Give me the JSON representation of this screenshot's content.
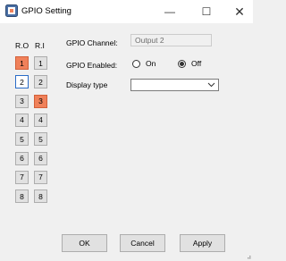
{
  "window": {
    "title": "GPIO Setting",
    "min_glyph": "—",
    "max_glyph": "☐",
    "close_glyph": "✕"
  },
  "pins": {
    "ro_header": "R.O",
    "ri_header": "R.I",
    "ro": [
      {
        "label": "1",
        "state": "active"
      },
      {
        "label": "2",
        "state": "focused"
      },
      {
        "label": "3",
        "state": "normal"
      },
      {
        "label": "4",
        "state": "normal"
      },
      {
        "label": "5",
        "state": "normal"
      },
      {
        "label": "6",
        "state": "normal"
      },
      {
        "label": "7",
        "state": "normal"
      },
      {
        "label": "8",
        "state": "normal"
      }
    ],
    "ri": [
      {
        "label": "1",
        "state": "normal"
      },
      {
        "label": "2",
        "state": "normal"
      },
      {
        "label": "3",
        "state": "active"
      },
      {
        "label": "4",
        "state": "normal"
      },
      {
        "label": "5",
        "state": "normal"
      },
      {
        "label": "6",
        "state": "normal"
      },
      {
        "label": "7",
        "state": "normal"
      },
      {
        "label": "8",
        "state": "normal"
      }
    ],
    "active_color": "#f0815a"
  },
  "form": {
    "channel_label": "GPIO Channel:",
    "channel_value": "Output 2",
    "enabled_label": "GPIO Enabled:",
    "enabled_on_label": "On",
    "enabled_off_label": "Off",
    "enabled_value": "Off",
    "display_type_label": "Display type",
    "display_type_value": ""
  },
  "buttons": {
    "ok": "OK",
    "cancel": "Cancel",
    "apply": "Apply"
  }
}
